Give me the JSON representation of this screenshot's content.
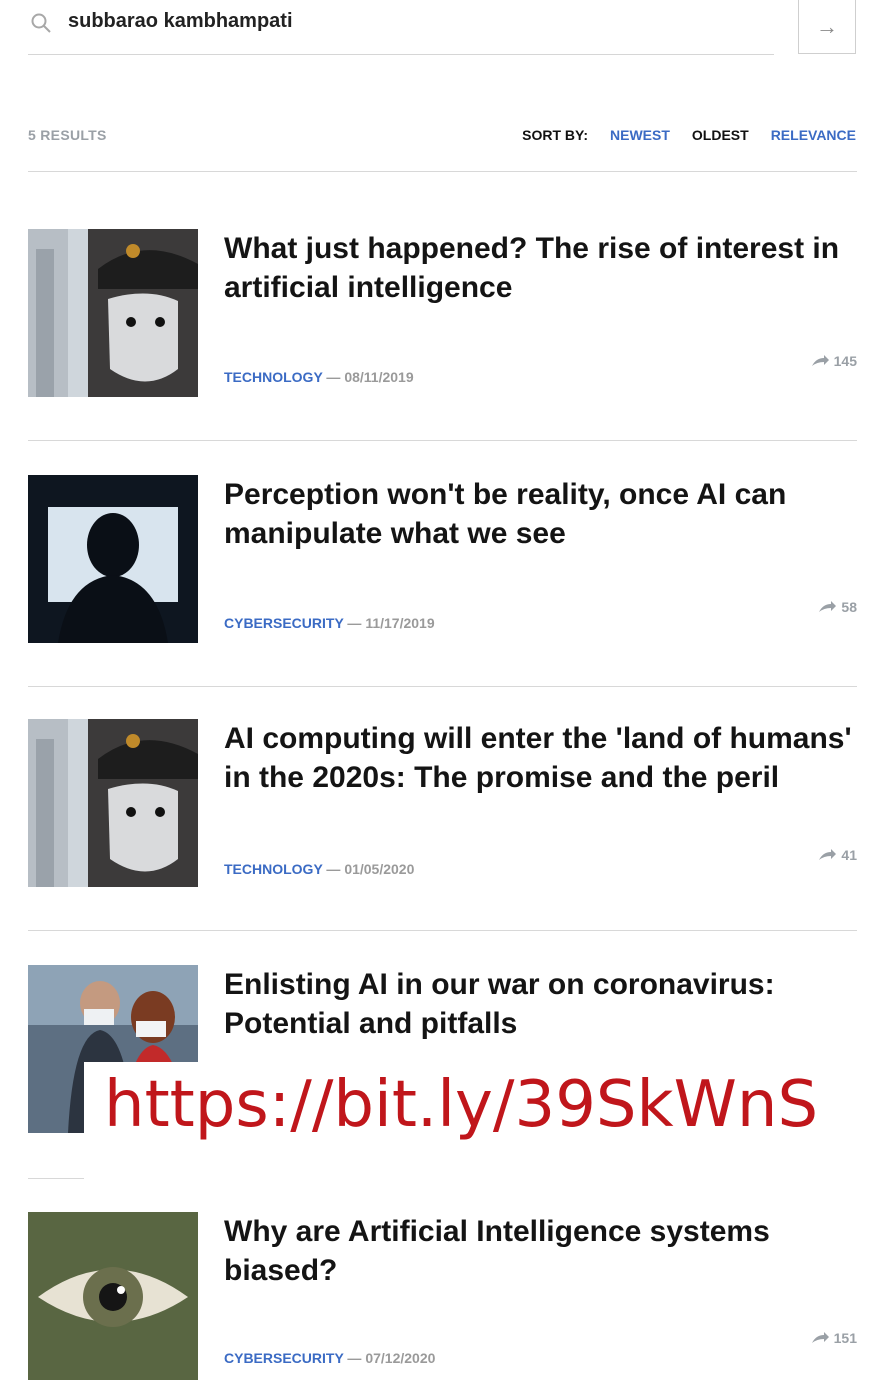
{
  "search": {
    "query": "subbarao kambhampati",
    "go_icon": "arrow-right-icon"
  },
  "results": {
    "count_label": "5 RESULTS",
    "sort_label": "SORT BY:",
    "sort_options": [
      "NEWEST",
      "OLDEST",
      "RELEVANCE"
    ]
  },
  "articles": [
    {
      "title": "What just happened? The rise of interest in artificial intelligence",
      "category": "TECHNOLOGY",
      "date": "08/11/2019",
      "shares": "145"
    },
    {
      "title": "Perception won't be reality, once AI can manipulate what we see",
      "category": "CYBERSECURITY",
      "date": "11/17/2019",
      "shares": "58"
    },
    {
      "title": "AI computing will enter the 'land of humans' in the 2020s: The promise and the peril",
      "category": "TECHNOLOGY",
      "date": "01/05/2020",
      "shares": "41"
    },
    {
      "title": "Enlisting AI in our war on coronavirus: Potential and pitfalls",
      "category": "",
      "date": "",
      "shares": ""
    },
    {
      "title": "Why are Artificial Intelligence systems biased?",
      "category": "CYBERSECURITY",
      "date": "07/12/2020",
      "shares": "151"
    }
  ],
  "overlay_url": "https://bit.ly/39SkWnS",
  "colors": {
    "link_blue": "#3b6bc4",
    "overlay_red": "#c0161b"
  }
}
